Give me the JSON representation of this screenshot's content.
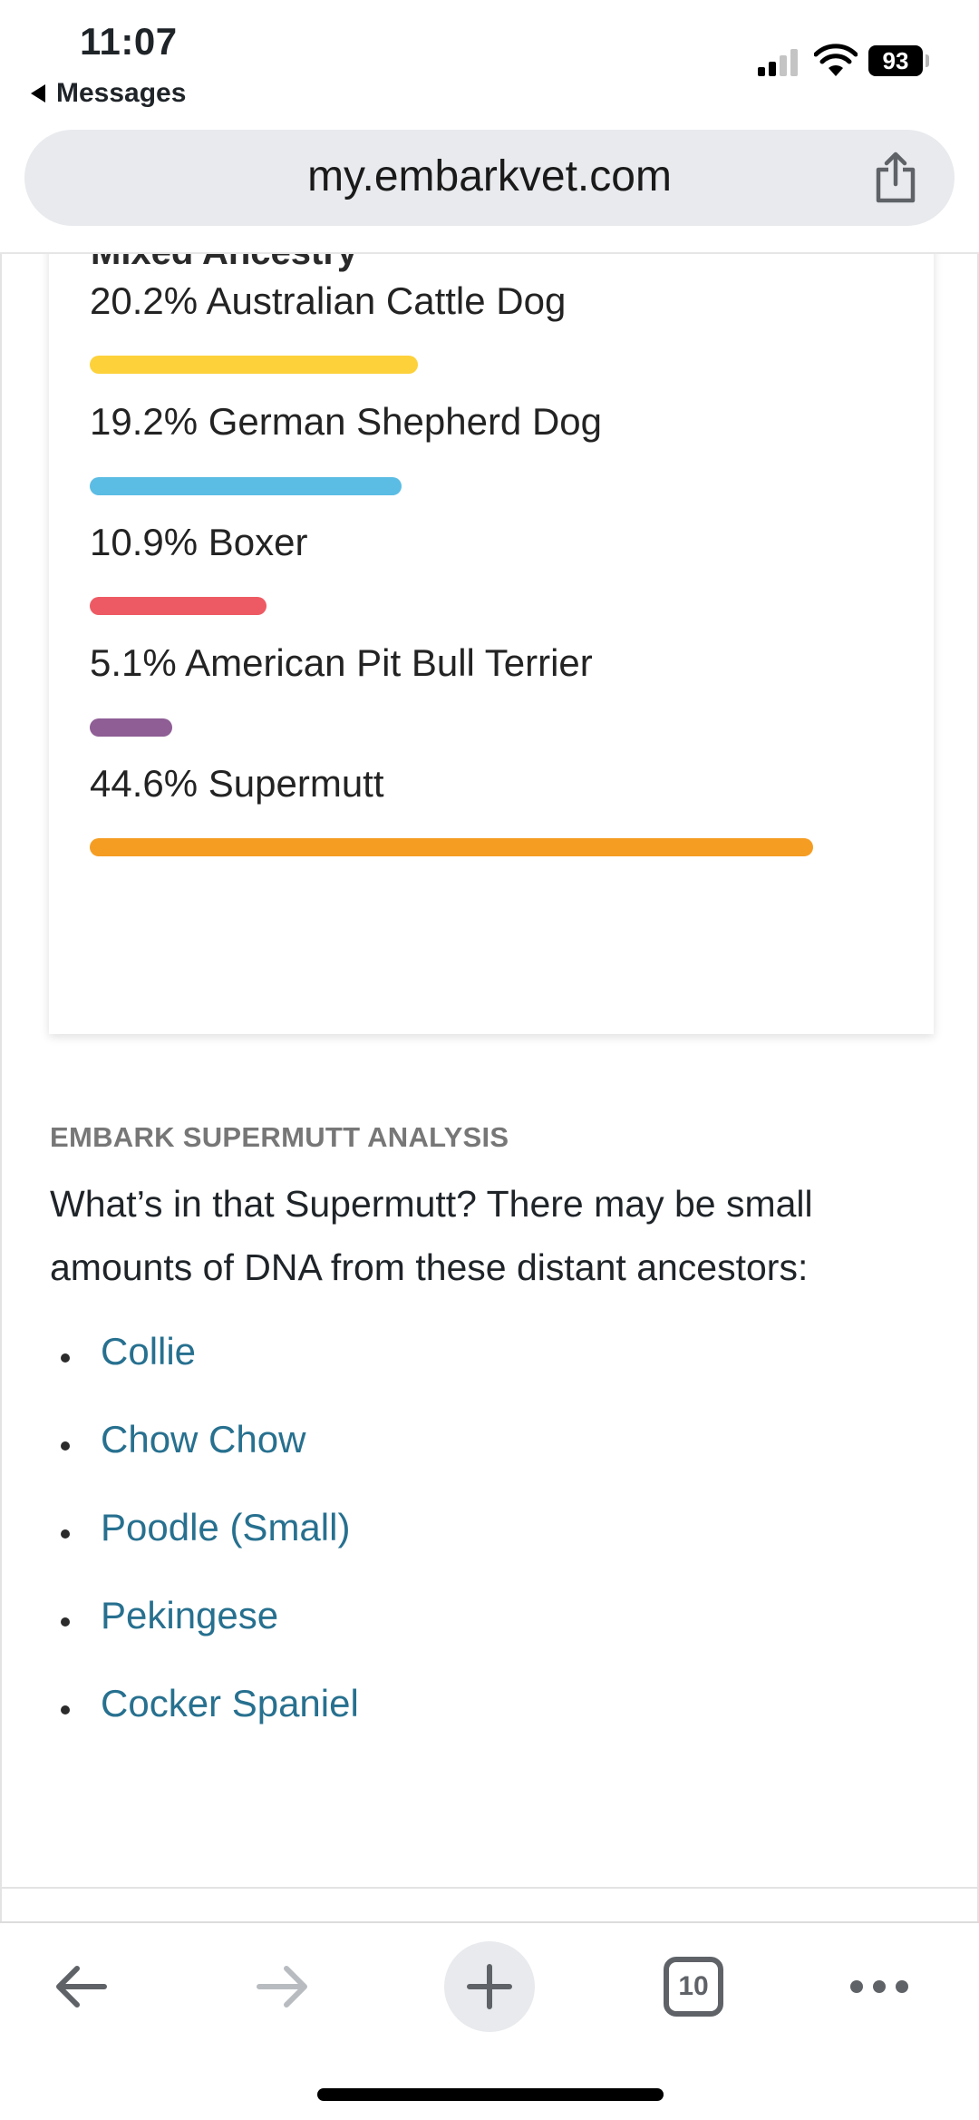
{
  "status_bar": {
    "time": "11:07",
    "back_label": "Messages",
    "battery": "93"
  },
  "browser": {
    "url": "my.embarkvet.com",
    "tab_count": "10"
  },
  "ancestry_card": {
    "title": "Mixed Ancestry",
    "breeds": [
      {
        "label": "20.2% Australian Cattle Dog",
        "percent": 20.2,
        "color": "#fdd13a"
      },
      {
        "label": "19.2% German Shepherd Dog",
        "percent": 19.2,
        "color": "#5bbde4"
      },
      {
        "label": "10.9% Boxer",
        "percent": 10.9,
        "color": "#ee5a63"
      },
      {
        "label": "5.1% American Pit Bull Terrier",
        "percent": 5.1,
        "color": "#8e5e95"
      },
      {
        "label": "44.6% Supermutt",
        "percent": 44.6,
        "color": "#f59d23"
      }
    ]
  },
  "supermutt": {
    "heading": "EMBARK SUPERMUTT ANALYSIS",
    "text": "What’s in that Supermutt? There may be small amounts of DNA from these distant ancestors:",
    "ancestors": [
      "Collie",
      "Chow Chow",
      "Poodle (Small)",
      "Pekingese",
      "Cocker Spaniel"
    ],
    "link_color": "#27708f"
  }
}
